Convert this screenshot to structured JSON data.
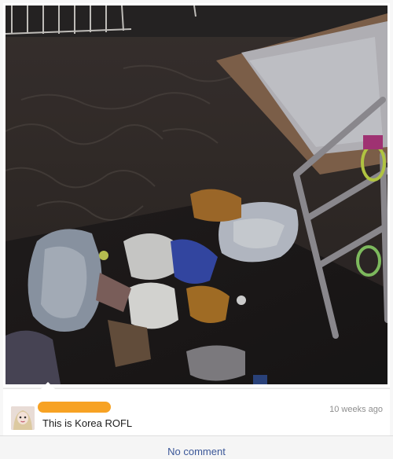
{
  "post": {
    "photo_description_icon": "trash-photo",
    "author_name_redacted": true,
    "author_redaction_color": "#f7a223",
    "timestamp": "10 weeks ago",
    "text": "This is Korea ROFL"
  },
  "footer": {
    "comment_link": "No comment"
  },
  "colors": {
    "link": "#3b5798",
    "muted": "#8e8e8e"
  }
}
